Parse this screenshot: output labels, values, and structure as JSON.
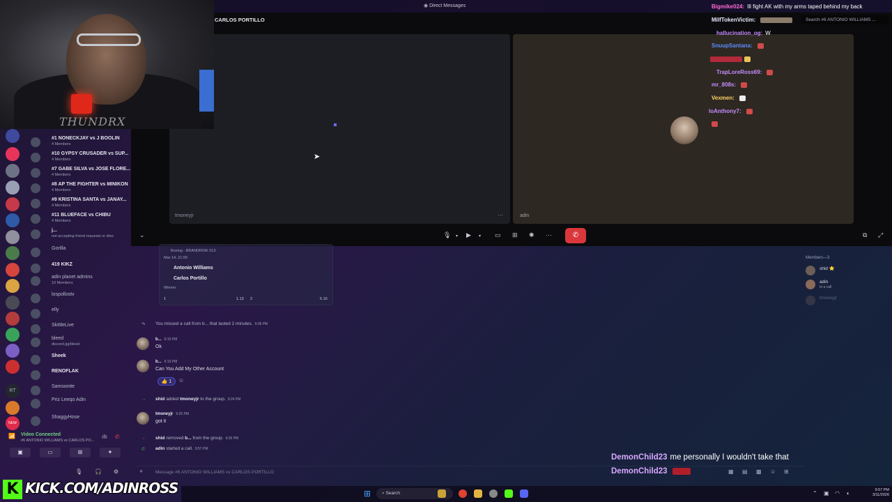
{
  "window": {
    "title": "Direct Messages",
    "search_placeholder": "Search #6 ANTONIO WILLIAMS ..."
  },
  "webcam": {
    "logo_text": "THUNDRX"
  },
  "call": {
    "title": "CARLOS PORTILLO",
    "left_tile_label": "tmoneyjr",
    "right_tile_label": "adin",
    "more": "···",
    "end_call": "✆"
  },
  "sidebar": {
    "channels": [
      {
        "name": "#1 NONECKJAY vs J BOOLIN",
        "sub": "4 Members"
      },
      {
        "name": "#10 GYPSY CRUSADER vs SUP...",
        "sub": "4 Members"
      },
      {
        "name": "#7 GABE SILVA vs JOSE FLORE...",
        "sub": "4 Members"
      },
      {
        "name": "#8 AP THE FIGHTER vs MINIKON",
        "sub": "4 Members"
      },
      {
        "name": "#9 KRISTINA SANTA vs JANAY...",
        "sub": "4 Members"
      },
      {
        "name": "#11 BLUEFACE vs CHIBU",
        "sub": "4 Members"
      },
      {
        "name": "j...",
        "sub": "not accepting friend requests or dms"
      },
      {
        "name": "Gorilla",
        "sub": ""
      },
      {
        "name": "419 KIKZ",
        "sub": ""
      },
      {
        "name": "adin planet admins",
        "sub": "10 Members"
      },
      {
        "name": "lospollostv",
        "sub": ""
      },
      {
        "name": "elly",
        "sub": ""
      },
      {
        "name": "SkittleLive",
        "sub": ""
      },
      {
        "name": "bleed",
        "sub": "discord.gg/bleed"
      },
      {
        "name": "Sheek",
        "sub": ""
      },
      {
        "name": "RENOFLAK",
        "sub": ""
      },
      {
        "name": "Samsonite",
        "sub": ""
      },
      {
        "name": "Priz Leeqo Adin",
        "sub": ""
      },
      {
        "name": "ShaggyHose",
        "sub": ""
      }
    ],
    "voice": {
      "status": "Video Connected",
      "channel": "#6 ANTONIO WILLIAMS vs CARLOS PO..."
    }
  },
  "kick": {
    "watermark": "KICK.COM/ADINROSS"
  },
  "kick_chat_top": [
    {
      "user": "Bigmike024:",
      "msg": "Ill fight AK with my arms taped behind my back",
      "color": "#ff6ad5"
    },
    {
      "user": "MilfTokenVictim:",
      "msg": "",
      "color": "#e8e8ff"
    },
    {
      "user": "hallucination_og:",
      "msg": "W",
      "color": "#c58cff"
    },
    {
      "user": "SnuupSantana:",
      "msg": "",
      "color": "#5b8cff"
    },
    {
      "user": "TrapLoreRoss69:",
      "msg": "",
      "color": "#c58cff"
    },
    {
      "user": "mr_808s:",
      "msg": "",
      "color": "#c58cff"
    },
    {
      "user": "Vexmen:",
      "msg": "",
      "color": "#ffd166"
    },
    {
      "user": "loAnthony7:",
      "msg": "",
      "color": "#c58cff"
    }
  ],
  "kick_chat_bottom": [
    {
      "user": "DemonChild23",
      "msg": "me personally I wouldn't take that",
      "color": "#d8a8ff"
    },
    {
      "user": "DemonChild23",
      "msg": "",
      "color": "#d8a8ff"
    }
  ],
  "bet_card": {
    "header": "Boxing - BRANDRISK 013",
    "date": "Mar 14, 21:00",
    "fighter1": "Antonio Williams",
    "fighter2": "Carlos Portillo",
    "market": "Winner",
    "odds": [
      "1",
      "1.13",
      "2",
      "5.10"
    ]
  },
  "messages": {
    "missed_call": {
      "text": "You missed a call from b... that lasted 2 minutes.",
      "time": "9:08 PM"
    },
    "m1": {
      "author": "b...",
      "time": "9:10 PM",
      "text": "Ok"
    },
    "m2": {
      "author": "b...",
      "time": "9:19 PM",
      "text": "Can You Add My Other Account"
    },
    "reaction": "👍 1",
    "added": {
      "actor": "shid",
      "mid": "added",
      "target": "tmoneyjr",
      "end": "to the group.",
      "time": "9:24 PM"
    },
    "m3": {
      "author": "tmoneyjr",
      "time": "9:25 PM",
      "text": "got it"
    },
    "removed": {
      "actor": "shid",
      "mid": "removed",
      "target": "b...",
      "end": "from the group.",
      "time": "9:26 PM"
    },
    "started": {
      "actor": "adin",
      "end": "started a call.",
      "time": "9:57 PM"
    }
  },
  "members": {
    "header": "Members—3",
    "list": [
      {
        "name": "shid ⭐",
        "status": ""
      },
      {
        "name": "adin",
        "status": "In a call"
      },
      {
        "name": "tmoneyjr",
        "status": ""
      }
    ]
  },
  "input": {
    "placeholder": "Message #6 ANTONIO WILLIAMS vs CARLOS PORTILLO"
  },
  "taskbar": {
    "search": "Search",
    "time": "9:57 PM",
    "date": "3/11/2026"
  }
}
